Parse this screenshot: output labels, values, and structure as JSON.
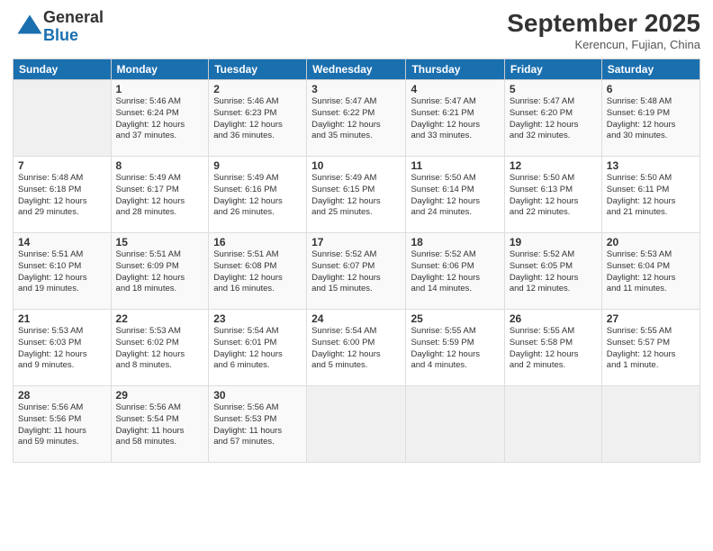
{
  "logo": {
    "general": "General",
    "blue": "Blue"
  },
  "header": {
    "month": "September 2025",
    "location": "Kerencun, Fujian, China"
  },
  "days_of_week": [
    "Sunday",
    "Monday",
    "Tuesday",
    "Wednesday",
    "Thursday",
    "Friday",
    "Saturday"
  ],
  "weeks": [
    [
      {
        "day": "",
        "info": ""
      },
      {
        "day": "1",
        "info": "Sunrise: 5:46 AM\nSunset: 6:24 PM\nDaylight: 12 hours\nand 37 minutes."
      },
      {
        "day": "2",
        "info": "Sunrise: 5:46 AM\nSunset: 6:23 PM\nDaylight: 12 hours\nand 36 minutes."
      },
      {
        "day": "3",
        "info": "Sunrise: 5:47 AM\nSunset: 6:22 PM\nDaylight: 12 hours\nand 35 minutes."
      },
      {
        "day": "4",
        "info": "Sunrise: 5:47 AM\nSunset: 6:21 PM\nDaylight: 12 hours\nand 33 minutes."
      },
      {
        "day": "5",
        "info": "Sunrise: 5:47 AM\nSunset: 6:20 PM\nDaylight: 12 hours\nand 32 minutes."
      },
      {
        "day": "6",
        "info": "Sunrise: 5:48 AM\nSunset: 6:19 PM\nDaylight: 12 hours\nand 30 minutes."
      }
    ],
    [
      {
        "day": "7",
        "info": "Sunrise: 5:48 AM\nSunset: 6:18 PM\nDaylight: 12 hours\nand 29 minutes."
      },
      {
        "day": "8",
        "info": "Sunrise: 5:49 AM\nSunset: 6:17 PM\nDaylight: 12 hours\nand 28 minutes."
      },
      {
        "day": "9",
        "info": "Sunrise: 5:49 AM\nSunset: 6:16 PM\nDaylight: 12 hours\nand 26 minutes."
      },
      {
        "day": "10",
        "info": "Sunrise: 5:49 AM\nSunset: 6:15 PM\nDaylight: 12 hours\nand 25 minutes."
      },
      {
        "day": "11",
        "info": "Sunrise: 5:50 AM\nSunset: 6:14 PM\nDaylight: 12 hours\nand 24 minutes."
      },
      {
        "day": "12",
        "info": "Sunrise: 5:50 AM\nSunset: 6:13 PM\nDaylight: 12 hours\nand 22 minutes."
      },
      {
        "day": "13",
        "info": "Sunrise: 5:50 AM\nSunset: 6:11 PM\nDaylight: 12 hours\nand 21 minutes."
      }
    ],
    [
      {
        "day": "14",
        "info": "Sunrise: 5:51 AM\nSunset: 6:10 PM\nDaylight: 12 hours\nand 19 minutes."
      },
      {
        "day": "15",
        "info": "Sunrise: 5:51 AM\nSunset: 6:09 PM\nDaylight: 12 hours\nand 18 minutes."
      },
      {
        "day": "16",
        "info": "Sunrise: 5:51 AM\nSunset: 6:08 PM\nDaylight: 12 hours\nand 16 minutes."
      },
      {
        "day": "17",
        "info": "Sunrise: 5:52 AM\nSunset: 6:07 PM\nDaylight: 12 hours\nand 15 minutes."
      },
      {
        "day": "18",
        "info": "Sunrise: 5:52 AM\nSunset: 6:06 PM\nDaylight: 12 hours\nand 14 minutes."
      },
      {
        "day": "19",
        "info": "Sunrise: 5:52 AM\nSunset: 6:05 PM\nDaylight: 12 hours\nand 12 minutes."
      },
      {
        "day": "20",
        "info": "Sunrise: 5:53 AM\nSunset: 6:04 PM\nDaylight: 12 hours\nand 11 minutes."
      }
    ],
    [
      {
        "day": "21",
        "info": "Sunrise: 5:53 AM\nSunset: 6:03 PM\nDaylight: 12 hours\nand 9 minutes."
      },
      {
        "day": "22",
        "info": "Sunrise: 5:53 AM\nSunset: 6:02 PM\nDaylight: 12 hours\nand 8 minutes."
      },
      {
        "day": "23",
        "info": "Sunrise: 5:54 AM\nSunset: 6:01 PM\nDaylight: 12 hours\nand 6 minutes."
      },
      {
        "day": "24",
        "info": "Sunrise: 5:54 AM\nSunset: 6:00 PM\nDaylight: 12 hours\nand 5 minutes."
      },
      {
        "day": "25",
        "info": "Sunrise: 5:55 AM\nSunset: 5:59 PM\nDaylight: 12 hours\nand 4 minutes."
      },
      {
        "day": "26",
        "info": "Sunrise: 5:55 AM\nSunset: 5:58 PM\nDaylight: 12 hours\nand 2 minutes."
      },
      {
        "day": "27",
        "info": "Sunrise: 5:55 AM\nSunset: 5:57 PM\nDaylight: 12 hours\nand 1 minute."
      }
    ],
    [
      {
        "day": "28",
        "info": "Sunrise: 5:56 AM\nSunset: 5:56 PM\nDaylight: 11 hours\nand 59 minutes."
      },
      {
        "day": "29",
        "info": "Sunrise: 5:56 AM\nSunset: 5:54 PM\nDaylight: 11 hours\nand 58 minutes."
      },
      {
        "day": "30",
        "info": "Sunrise: 5:56 AM\nSunset: 5:53 PM\nDaylight: 11 hours\nand 57 minutes."
      },
      {
        "day": "",
        "info": ""
      },
      {
        "day": "",
        "info": ""
      },
      {
        "day": "",
        "info": ""
      },
      {
        "day": "",
        "info": ""
      }
    ]
  ]
}
